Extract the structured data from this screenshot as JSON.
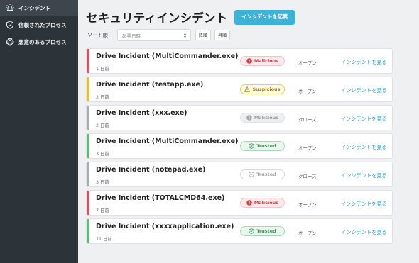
{
  "sidebar": {
    "items": [
      {
        "label": "インシデント",
        "icon": "alert-beacon-icon",
        "active": true
      },
      {
        "label": "信頼されたプロセス",
        "icon": "shield-check-icon",
        "active": false
      },
      {
        "label": "悪意のあるプロセス",
        "icon": "gear-icon",
        "active": false
      }
    ]
  },
  "header": {
    "title": "セキュリティインシデント",
    "raise_button": "インシデントを起票"
  },
  "sort": {
    "label": "ソート順：",
    "select_placeholder": "起票日時",
    "asc_label": "降順",
    "desc_label": "昇順"
  },
  "incidents": [
    {
      "title": "Drive Incident (MultiCommander.exe)",
      "time": "1 日前",
      "status": "Malicious",
      "state": "オープン",
      "link": "インシデントを見る",
      "stripe": "#d9505e",
      "variant": "malicious"
    },
    {
      "title": "Drive Incident (testapp.exe)",
      "time": "2 日前",
      "status": "Suspicious",
      "state": "オープン",
      "link": "インシデントを見る",
      "stripe": "#e3c22e",
      "variant": "suspicious"
    },
    {
      "title": "Drive Incident (xxx.exe)",
      "time": "2 日前",
      "status": "Malicious",
      "state": "クローズ",
      "link": "インシデントを見る",
      "stripe": "#a9adb1",
      "variant": "malicious-muted"
    },
    {
      "title": "Drive Incident (MultiCommander.exe)",
      "time": "3 日前",
      "status": "Trusted",
      "state": "オープン",
      "link": "インシデントを見る",
      "stripe": "#5fb977",
      "variant": "trusted"
    },
    {
      "title": "Drive Incident (notepad.exe)",
      "time": "3 日前",
      "status": "Trusted",
      "state": "クローズ",
      "link": "インシデントを見る",
      "stripe": "#a9adb1",
      "variant": "trusted-muted"
    },
    {
      "title": "Drive Incident (TOTALCMD64.exe)",
      "time": "7 日前",
      "status": "Malicious",
      "state": "オープン",
      "link": "インシデントを見る",
      "stripe": "#d9505e",
      "variant": "malicious"
    },
    {
      "title": "Drive Incident (xxxxapplication.exe)",
      "time": "11 日前",
      "status": "Trusted",
      "state": "オープン",
      "link": "インシデントを見る",
      "stripe": "#5fb977",
      "variant": "trusted"
    }
  ]
}
